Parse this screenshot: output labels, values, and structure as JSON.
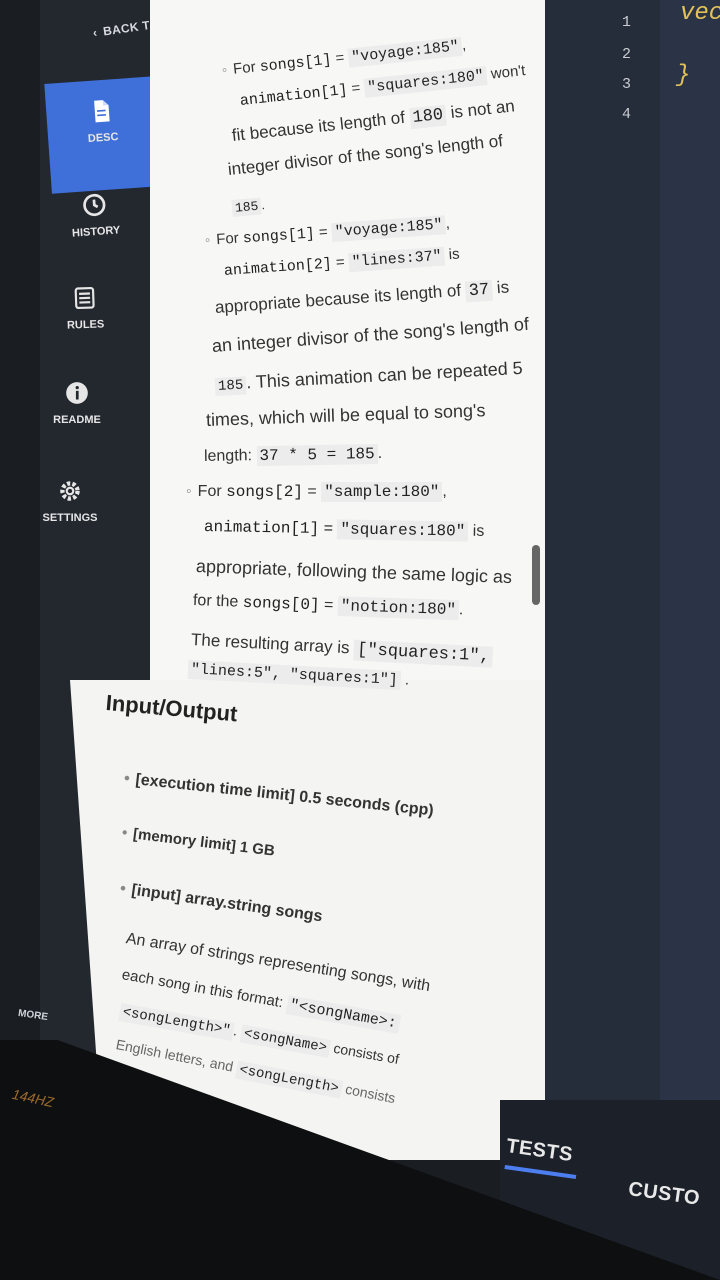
{
  "sidebar": {
    "back_label": "BACK TO QUESTIONS",
    "items": [
      {
        "label": "DESC",
        "icon": "document-icon"
      },
      {
        "label": "HISTORY",
        "icon": "clock-icon"
      },
      {
        "label": "RULES",
        "icon": "list-icon"
      },
      {
        "label": "README",
        "icon": "info-icon"
      },
      {
        "label": "SETTINGS",
        "icon": "gear-icon"
      }
    ],
    "more_label": "MORE"
  },
  "description": {
    "l1_a": "For",
    "l1_code1": "songs[1]",
    "l1_eq": "=",
    "l1_code2": "\"voyage:185\"",
    "l1_comma": ",",
    "l2_code1": "animation[1]",
    "l2_eq": "=",
    "l2_code2": "\"squares:180\"",
    "l2_b": "won't",
    "l3_a": "fit because its length of",
    "l3_code": "180",
    "l3_b": "is not an",
    "l4": "integer divisor of the song's length of",
    "l5_code": "185",
    "l5_b": ".",
    "l6_a": "For",
    "l6_code1": "songs[1]",
    "l6_eq": "=",
    "l6_code2": "\"voyage:185\"",
    "l6_comma": ",",
    "l7_code1": "animation[2]",
    "l7_eq": "=",
    "l7_code2": "\"lines:37\"",
    "l7_b": "is",
    "l8_a": "appropriate because its length of",
    "l8_code": "37",
    "l8_b": "is",
    "l9": "an integer divisor of the song's length of",
    "l10_code": "185",
    "l10_b": ". This animation can be repeated 5",
    "l11": "times, which will be equal to song's",
    "l12_a": "length:",
    "l12_code": "37 * 5 = 185",
    "l12_b": ".",
    "l13_a": "For",
    "l13_code1": "songs[2]",
    "l13_eq": "=",
    "l13_code2": "\"sample:180\"",
    "l13_comma": ",",
    "l14_code1": "animation[1]",
    "l14_eq": "=",
    "l14_code2": "\"squares:180\"",
    "l14_b": "is",
    "l15": "appropriate, following the same logic as",
    "l16_a": "for the",
    "l16_code1": "songs[0]",
    "l16_eq": "=",
    "l16_code2": "\"notion:180\"",
    "l16_b": ".",
    "l17_a": "The resulting array is",
    "l17_code": "[\"squares:1\",",
    "l18_code": "\"lines:5\", \"squares:1\"]",
    "l18_b": "."
  },
  "io": {
    "heading": "Input/Output",
    "b1": "[execution time limit] 0.5 seconds (cpp)",
    "b2": "[memory limit] 1 GB",
    "b3": "[input] array.string songs",
    "p1": "An array of strings representing songs, with",
    "p2_a": "each song in this format:",
    "p2_code": "\"<songName>:",
    "p3_code1": "<songLength>\"",
    "p3_dot": ".",
    "p3_code2": "<songName>",
    "p3_b": "consists of",
    "p4_a": "English letters, and",
    "p4_code": "<songLength>",
    "p4_b": "consists"
  },
  "editor": {
    "line_numbers": [
      "1",
      "2",
      "3",
      "4"
    ],
    "code_top": "vec",
    "code_brace": "}"
  },
  "bottom_tabs": {
    "tests": "TESTS",
    "custom": "CUSTO"
  },
  "monitor_badge": "144HZ",
  "colors": {
    "accent": "#3f6fd8",
    "sidebar": "#23272e",
    "editor": "#262d3a",
    "keyword": "#e2c05a"
  }
}
